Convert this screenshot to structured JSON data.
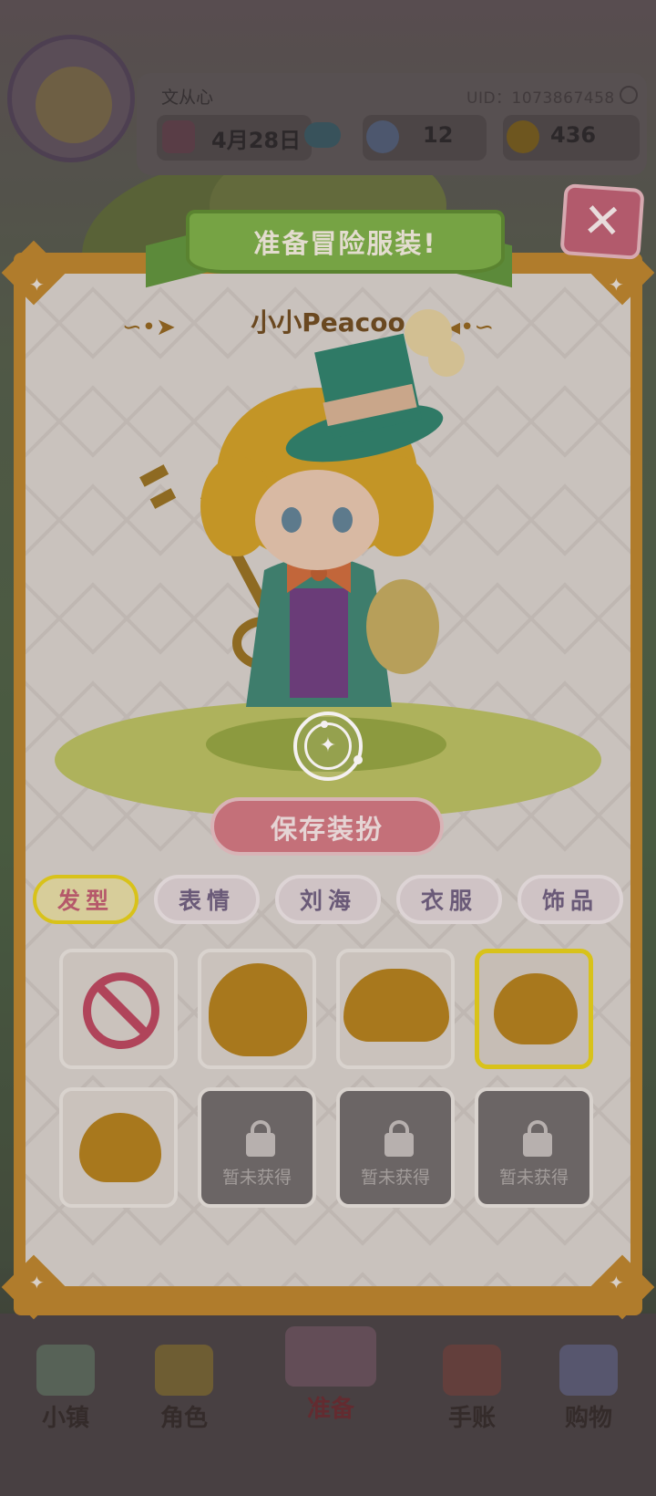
{
  "header": {
    "username": "文从心",
    "uid": "UID：1073867458",
    "date": "4月28日",
    "gems": "12",
    "coins": "436"
  },
  "bottom_nav": {
    "items": [
      {
        "label": "小镇",
        "icon": "map-icon"
      },
      {
        "label": "角色",
        "icon": "character-icon"
      },
      {
        "label": "准备",
        "icon": "wardrobe-icon"
      },
      {
        "label": "手账",
        "icon": "journal-icon"
      },
      {
        "label": "购物",
        "icon": "shopping-bag-icon"
      }
    ]
  },
  "dialog": {
    "title": "准备冒险服装!",
    "character_name": "小小Peacoo",
    "save_label": "保存装扮",
    "close_symbol": "✕",
    "rotate_symbol": "✦",
    "categories": [
      {
        "label": "发型",
        "active": true
      },
      {
        "label": "表情",
        "active": false
      },
      {
        "label": "刘海",
        "active": false
      },
      {
        "label": "衣服",
        "active": false
      },
      {
        "label": "饰品",
        "active": false
      }
    ],
    "hair_slots": [
      {
        "type": "none"
      },
      {
        "type": "hair",
        "style": "long-round"
      },
      {
        "type": "hair",
        "style": "bob-wide"
      },
      {
        "type": "hair",
        "style": "short-wavy",
        "selected": true
      },
      {
        "type": "hair",
        "style": "curly-short"
      },
      {
        "type": "locked",
        "label": "暂未获得"
      },
      {
        "type": "locked",
        "label": "暂未获得"
      },
      {
        "type": "locked",
        "label": "暂未获得"
      }
    ]
  },
  "colors": {
    "frame": "#b07c2c",
    "accent_yellow": "#d8c21a",
    "save_pink": "#c47079",
    "ribbon_green": "#76a344",
    "hair_gold": "#a8781d"
  }
}
